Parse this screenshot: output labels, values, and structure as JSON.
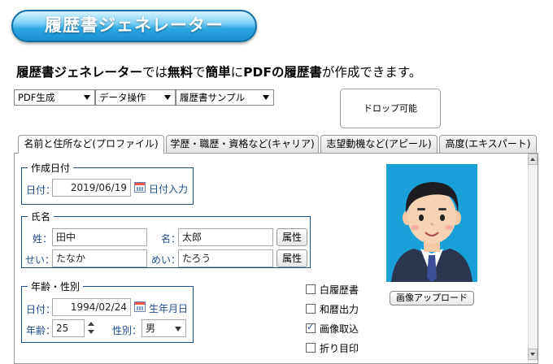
{
  "logo": {
    "text": "履歴書ジェネレーター"
  },
  "headline": {
    "part1": "履歴書ジェネレーター",
    "part2": "では",
    "part3": "無料",
    "part4": "で",
    "part5": "簡単",
    "part6": "に",
    "part7": "PDFの履歴書",
    "part8": "が作成できます。"
  },
  "toolbar": {
    "pdf_select": "PDF生成",
    "data_select": "データ操作",
    "sample_select": "履歴書サンプル",
    "drop_zone": "ドロップ可能"
  },
  "tabs": [
    {
      "label": "名前と住所など(プロファイル)"
    },
    {
      "label": "学歴・職歴・資格など(キャリア)"
    },
    {
      "label": "志望動機など(アピール)"
    },
    {
      "label": "高度(エキスパート)"
    }
  ],
  "created": {
    "legend": "作成日付",
    "date_label": "日付：",
    "date_value": "2019/06/19",
    "date_button": "日付入力"
  },
  "name": {
    "legend": "氏名",
    "sei_label": "姓：",
    "sei_value": "田中",
    "mei_label": "名：",
    "mei_value": "太郎",
    "sei_kana_label": "せい：",
    "sei_kana_value": "たなか",
    "mei_kana_label": "めい：",
    "mei_kana_value": "たろう",
    "attr_button_1": "属性",
    "attr_button_2": "属性"
  },
  "age": {
    "legend": "年齢・性別",
    "date_label": "日付：",
    "birth_value": "1994/02/24",
    "birth_button": "生年月日",
    "age_label": "年齢：",
    "age_value": "25",
    "gender_label": "性別：",
    "gender_value": "男"
  },
  "options": [
    {
      "label": "白履歴書",
      "checked": false
    },
    {
      "label": "和暦出力",
      "checked": false
    },
    {
      "label": "画像取込",
      "checked": true
    },
    {
      "label": "折り目印",
      "checked": false
    }
  ],
  "photo": {
    "upload_button": "画像アップロード"
  },
  "colors": {
    "accent": "#1e4d8c",
    "logo_blue": "#2ba6e2",
    "photo_bg": "#1aa0d8"
  }
}
